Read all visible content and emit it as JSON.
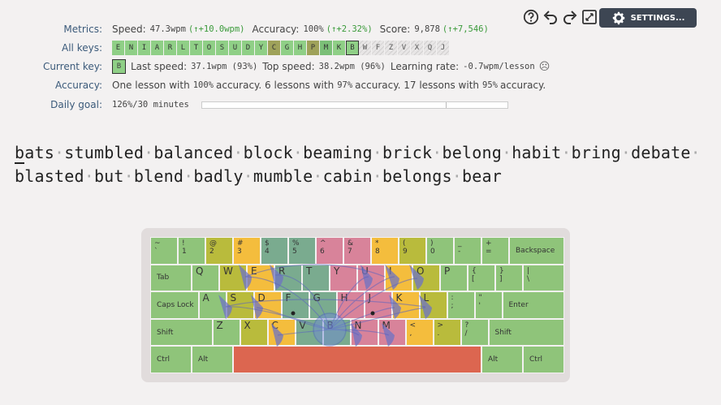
{
  "controls": {
    "settings_label": "SETTINGS..."
  },
  "metrics": {
    "label": "Metrics:",
    "speed_label": "Speed:",
    "speed_value": "47.3wpm",
    "speed_delta": "(↑+10.0wpm)",
    "accuracy_label": "Accuracy:",
    "accuracy_value": "100%",
    "accuracy_delta": "(↑+2.32%)",
    "score_label": "Score:",
    "score_value": "9,878",
    "score_delta": "(↑+7,546)"
  },
  "all_keys": {
    "label": "All keys:",
    "keys": [
      {
        "char": "E",
        "state": "g1"
      },
      {
        "char": "N",
        "state": "g1"
      },
      {
        "char": "I",
        "state": "g1"
      },
      {
        "char": "A",
        "state": "g1"
      },
      {
        "char": "R",
        "state": "g1"
      },
      {
        "char": "L",
        "state": "g1"
      },
      {
        "char": "T",
        "state": "g1"
      },
      {
        "char": "O",
        "state": "g1"
      },
      {
        "char": "S",
        "state": "g1"
      },
      {
        "char": "U",
        "state": "g1"
      },
      {
        "char": "D",
        "state": "g1"
      },
      {
        "char": "Y",
        "state": "g1"
      },
      {
        "char": "C",
        "state": "o"
      },
      {
        "char": "G",
        "state": "g1"
      },
      {
        "char": "H",
        "state": "g1"
      },
      {
        "char": "P",
        "state": "o"
      },
      {
        "char": "M",
        "state": "g2"
      },
      {
        "char": "K",
        "state": "g1"
      },
      {
        "char": "B",
        "state": "cur"
      },
      {
        "char": "W",
        "state": "lock"
      },
      {
        "char": "F",
        "state": "lock"
      },
      {
        "char": "Z",
        "state": "lock"
      },
      {
        "char": "V",
        "state": "lock"
      },
      {
        "char": "X",
        "state": "lock"
      },
      {
        "char": "Q",
        "state": "lock"
      },
      {
        "char": "J",
        "state": "lock"
      }
    ]
  },
  "current_key": {
    "label": "Current key:",
    "key": "B",
    "last_speed_label": "Last speed:",
    "last_speed_value": "37.1wpm (93%)",
    "top_speed_label": "Top speed:",
    "top_speed_value": "38.2wpm (96%)",
    "learning_rate_label": "Learning rate:",
    "learning_rate_value": "-0.7wpm/lesson",
    "mood_icon": "☹"
  },
  "accuracy_row": {
    "label": "Accuracy:",
    "t1": "One lesson with",
    "v1": "100%",
    "t2": "accuracy. 6 lessons with",
    "v2": "97%",
    "t3": "accuracy. 17 lessons with",
    "v3": "95%",
    "t4": "accuracy."
  },
  "daily_goal": {
    "label": "Daily goal:",
    "value": "126%/30 minutes",
    "progress": 0.8
  },
  "lesson": {
    "words": [
      "bats",
      "stumbled",
      "balanced",
      "block",
      "beaming",
      "brick",
      "belong",
      "habit",
      "bring",
      "debate",
      "blasted",
      "but",
      "blend",
      "badly",
      "mumble",
      "cabin",
      "belongs",
      "bear"
    ],
    "line_break_after": 9
  },
  "keyboard": {
    "rows": [
      [
        {
          "top": "~",
          "bot": "`",
          "c": "c-green",
          "w": 1
        },
        {
          "top": "!",
          "bot": "1",
          "c": "c-green",
          "w": 1
        },
        {
          "top": "@",
          "bot": "2",
          "c": "c-olive",
          "w": 1
        },
        {
          "top": "#",
          "bot": "3",
          "c": "c-yellow",
          "w": 1
        },
        {
          "top": "$",
          "bot": "4",
          "c": "c-teal",
          "w": 1
        },
        {
          "top": "%",
          "bot": "5",
          "c": "c-teal",
          "w": 1
        },
        {
          "top": "^",
          "bot": "6",
          "c": "c-pink",
          "w": 1
        },
        {
          "top": "&",
          "bot": "7",
          "c": "c-pink",
          "w": 1
        },
        {
          "top": "*",
          "bot": "8",
          "c": "c-yellow",
          "w": 1
        },
        {
          "top": "(",
          "bot": "9",
          "c": "c-olive",
          "w": 1
        },
        {
          "top": ")",
          "bot": "0",
          "c": "c-green",
          "w": 1
        },
        {
          "top": "_",
          "bot": "-",
          "c": "c-green",
          "w": 1
        },
        {
          "top": "+",
          "bot": "=",
          "c": "c-green",
          "w": 1
        },
        {
          "top": "Backspace",
          "bot": "",
          "c": "c-green",
          "w": 2
        }
      ],
      [
        {
          "top": "Tab",
          "bot": "",
          "c": "c-green",
          "w": 1.5
        },
        {
          "top": "Q",
          "bot": "",
          "c": "c-green",
          "w": 1,
          "big": true
        },
        {
          "top": "W",
          "bot": "",
          "c": "c-olive",
          "w": 1,
          "big": true
        },
        {
          "top": "E",
          "bot": "",
          "c": "c-yellow",
          "w": 1,
          "big": true
        },
        {
          "top": "R",
          "bot": "",
          "c": "c-teal",
          "w": 1,
          "big": true
        },
        {
          "top": "T",
          "bot": "",
          "c": "c-teal",
          "w": 1,
          "big": true
        },
        {
          "top": "Y",
          "bot": "",
          "c": "c-pink",
          "w": 1,
          "big": true
        },
        {
          "top": "U",
          "bot": "",
          "c": "c-pink",
          "w": 1,
          "big": true
        },
        {
          "top": "I",
          "bot": "",
          "c": "c-yellow",
          "w": 1,
          "big": true
        },
        {
          "top": "O",
          "bot": "",
          "c": "c-olive",
          "w": 1,
          "big": true
        },
        {
          "top": "P",
          "bot": "",
          "c": "c-green",
          "w": 1,
          "big": true
        },
        {
          "top": "{",
          "bot": "[",
          "c": "c-green",
          "w": 1
        },
        {
          "top": "}",
          "bot": "]",
          "c": "c-green",
          "w": 1
        },
        {
          "top": "|",
          "bot": "\\",
          "c": "c-green",
          "w": 1.5
        }
      ],
      [
        {
          "top": "Caps Lock",
          "bot": "",
          "c": "c-green",
          "w": 1.75
        },
        {
          "top": "A",
          "bot": "",
          "c": "c-green",
          "w": 1,
          "big": true
        },
        {
          "top": "S",
          "bot": "",
          "c": "c-olive",
          "w": 1,
          "big": true
        },
        {
          "top": "D",
          "bot": "",
          "c": "c-yellow",
          "w": 1,
          "big": true
        },
        {
          "top": "F",
          "bot": "",
          "c": "c-teal",
          "w": 1,
          "big": true
        },
        {
          "top": "G",
          "bot": "",
          "c": "c-teal",
          "w": 1,
          "big": true
        },
        {
          "top": "H",
          "bot": "",
          "c": "c-pink",
          "w": 1,
          "big": true
        },
        {
          "top": "J",
          "bot": "",
          "c": "c-pink",
          "w": 1,
          "big": true
        },
        {
          "top": "K",
          "bot": "",
          "c": "c-yellow",
          "w": 1,
          "big": true
        },
        {
          "top": "L",
          "bot": "",
          "c": "c-olive",
          "w": 1,
          "big": true
        },
        {
          "top": ":",
          "bot": ";",
          "c": "c-green",
          "w": 1
        },
        {
          "top": "\"",
          "bot": "'",
          "c": "c-green",
          "w": 1
        },
        {
          "top": "Enter",
          "bot": "",
          "c": "c-green",
          "w": 2.25
        }
      ],
      [
        {
          "top": "Shift",
          "bot": "",
          "c": "c-green",
          "w": 2.25
        },
        {
          "top": "Z",
          "bot": "",
          "c": "c-green",
          "w": 1,
          "big": true
        },
        {
          "top": "X",
          "bot": "",
          "c": "c-olive",
          "w": 1,
          "big": true
        },
        {
          "top": "C",
          "bot": "",
          "c": "c-yellow",
          "w": 1,
          "big": true
        },
        {
          "top": "V",
          "bot": "",
          "c": "c-teal",
          "w": 1,
          "big": true
        },
        {
          "top": "B",
          "bot": "",
          "c": "c-teal",
          "w": 1,
          "big": true
        },
        {
          "top": "N",
          "bot": "",
          "c": "c-pink",
          "w": 1,
          "big": true
        },
        {
          "top": "M",
          "bot": "",
          "c": "c-pink",
          "w": 1,
          "big": true
        },
        {
          "top": "<",
          "bot": ",",
          "c": "c-yellow",
          "w": 1
        },
        {
          "top": ">",
          "bot": ".",
          "c": "c-olive",
          "w": 1
        },
        {
          "top": "?",
          "bot": "/",
          "c": "c-green",
          "w": 1
        },
        {
          "top": "Shift",
          "bot": "",
          "c": "c-green",
          "w": 2.75
        }
      ],
      [
        {
          "top": "Ctrl",
          "bot": "",
          "c": "c-green",
          "w": 1.5
        },
        {
          "top": "Alt",
          "bot": "",
          "c": "c-green",
          "w": 1.5
        },
        {
          "top": "",
          "bot": "",
          "c": "c-red",
          "w": 9
        },
        {
          "top": "Alt",
          "bot": "",
          "c": "c-green",
          "w": 1.5
        },
        {
          "top": "Ctrl",
          "bot": "",
          "c": "c-green",
          "w": 1.5
        }
      ]
    ]
  }
}
